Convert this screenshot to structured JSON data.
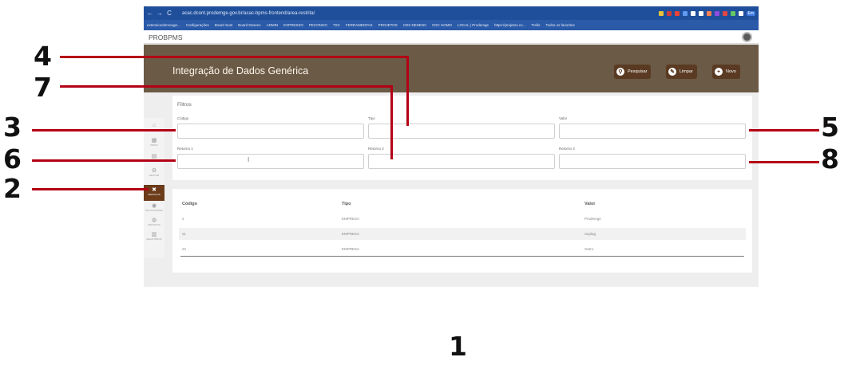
{
  "browser": {
    "url": "acac.dcont.prodemge.gov.br/acac-bpms-frontend/area-restrita/",
    "back": "←",
    "forward": "→",
    "reload": "C",
    "bookmarks": [
      "extensiondemouge...",
      "Configurações",
      "Board Sust",
      "Board Desenv",
      "ADMIN",
      "EXPRESSO",
      "PECONGO",
      "TSC",
      "FERRAMENTAS",
      "PROJETOS",
      "CDS DESENV",
      "CDC HOMO",
      "LOCAL | Prodemge",
      "https://projetos.co...",
      "Trello",
      "Todos os favoritos"
    ],
    "profile_label": "Em"
  },
  "app": {
    "name": "PROBPMS",
    "title": "Integração de Dados Genérica",
    "buttons": {
      "search": "Pesquisar",
      "clear": "Limpar",
      "new": "Novo"
    }
  },
  "rail": [
    {
      "icon": "⌂",
      "label": ""
    },
    {
      "icon": "▦",
      "label": "INÍCIO"
    },
    {
      "icon": "▤",
      "label": ""
    },
    {
      "icon": "⚙",
      "label": "GESTOR"
    },
    {
      "icon": "✖",
      "label": "SERVIÇOS"
    },
    {
      "icon": "◉",
      "label": "SOLICITAÇÕES"
    },
    {
      "icon": "◍",
      "label": "MÉTRICAS"
    },
    {
      "icon": "▥",
      "label": "RELATÓRIOS"
    }
  ],
  "filters": {
    "title": "Filtros",
    "codigo": {
      "label": "Código",
      "value": ""
    },
    "tipo": {
      "label": "Tipo",
      "value": ""
    },
    "valor": {
      "label": "Valor",
      "value": ""
    },
    "retorno1": {
      "label": "Retorno 1",
      "value": ""
    },
    "retorno2": {
      "label": "Retorno 2",
      "value": ""
    },
    "retorno3": {
      "label": "Retorno 3",
      "value": ""
    }
  },
  "table": {
    "headers": [
      "Código",
      "Tipo",
      "Valor"
    ],
    "rows": [
      [
        "2",
        "EMPRESA",
        "Prodemge"
      ],
      [
        "21",
        "EMPRESA",
        "Seplag"
      ],
      [
        "22",
        "EMPRESA",
        "Outro"
      ]
    ]
  },
  "callouts": [
    "1",
    "2",
    "3",
    "4",
    "5",
    "6",
    "7",
    "8"
  ],
  "colors": {
    "header_band": "#6b5a45",
    "button": "#5a3a22",
    "callout_line": "#b40014",
    "browser_bar": "#1f4f9b"
  }
}
